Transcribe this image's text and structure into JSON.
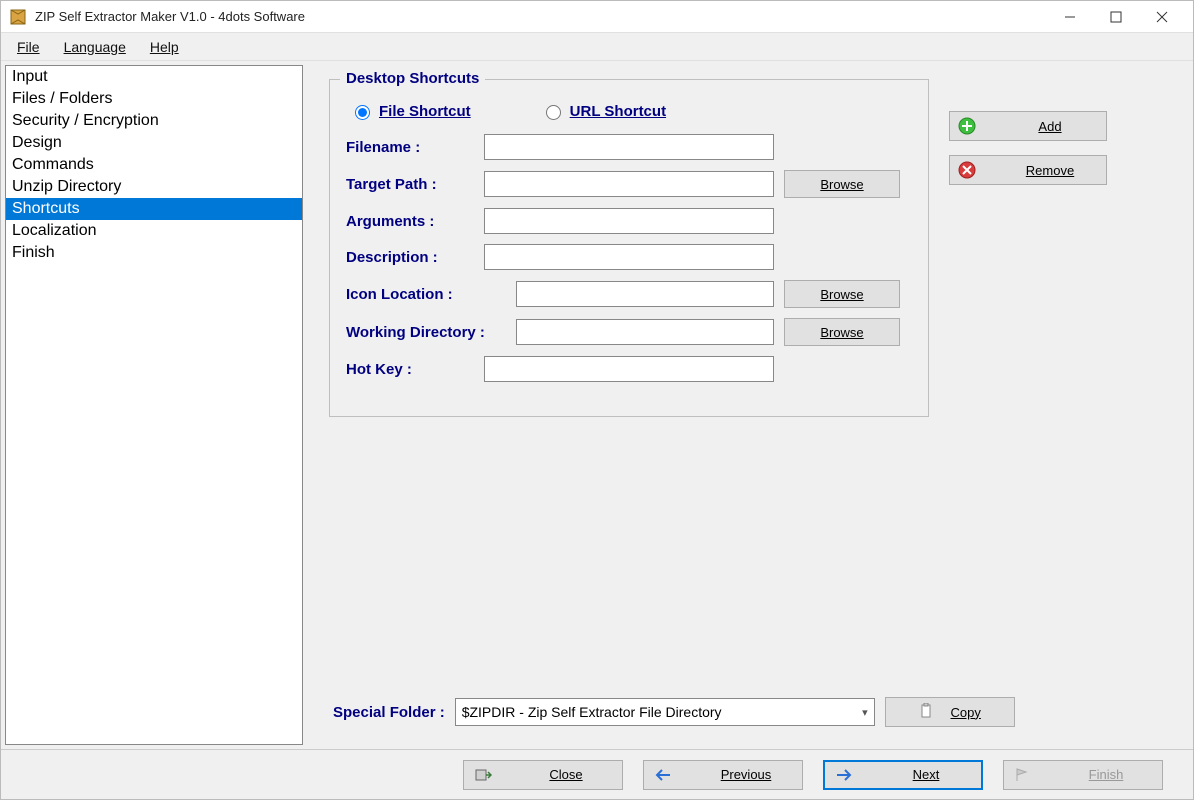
{
  "window": {
    "title": "ZIP Self Extractor Maker V1.0 - 4dots Software"
  },
  "menubar": {
    "file": "File",
    "language": "Language",
    "help": "Help"
  },
  "sidebar": {
    "items": [
      {
        "label": "Input",
        "selected": false
      },
      {
        "label": "Files / Folders",
        "selected": false
      },
      {
        "label": "Security / Encryption",
        "selected": false
      },
      {
        "label": "Design",
        "selected": false
      },
      {
        "label": "Commands",
        "selected": false
      },
      {
        "label": "Unzip Directory",
        "selected": false
      },
      {
        "label": "Shortcuts",
        "selected": true
      },
      {
        "label": "Localization",
        "selected": false
      },
      {
        "label": "Finish",
        "selected": false
      }
    ]
  },
  "shortcuts": {
    "group_title": "Desktop Shortcuts",
    "radio_file": "File Shortcut",
    "radio_url": "URL Shortcut",
    "radio_selected": "file",
    "labels": {
      "filename": "Filename :",
      "target_path": "Target Path :",
      "arguments": "Arguments :",
      "description": "Description :",
      "icon_location": "Icon Location :",
      "working_dir": "Working Directory :",
      "hot_key": "Hot Key :"
    },
    "values": {
      "filename": "",
      "target_path": "",
      "arguments": "",
      "description": "",
      "icon_location": "",
      "working_dir": "",
      "hot_key": ""
    },
    "browse_label": "Browse"
  },
  "side_buttons": {
    "add": "Add",
    "remove": "Remove"
  },
  "special_folder": {
    "label": "Special Folder :",
    "value": "$ZIPDIR - Zip Self Extractor File Directory",
    "copy_label": "Copy"
  },
  "bottom": {
    "close": "Close",
    "previous": "Previous",
    "next": "Next",
    "finish": "Finish"
  }
}
